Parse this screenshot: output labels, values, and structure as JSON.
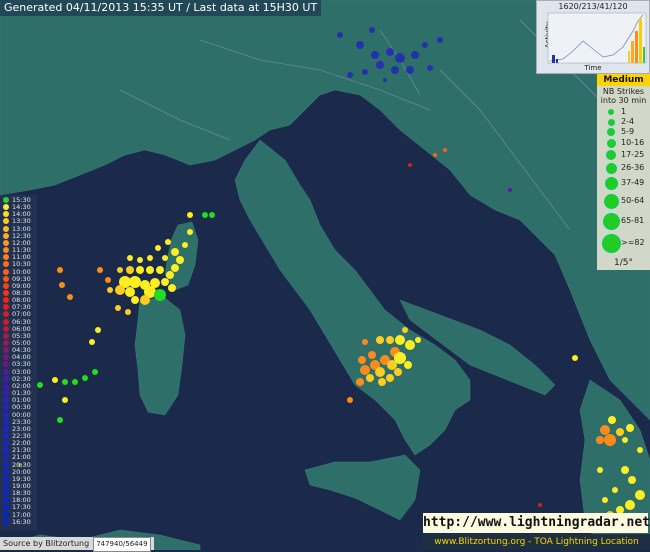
{
  "header": {
    "generated": "Generated 04/11/2013 15:35 UT / Last data at 15H30 UT"
  },
  "activity": {
    "title": "1620/213/41/120",
    "ylabel": "Activity",
    "xlabel": "Time"
  },
  "legend": {
    "title": "Medium",
    "subtitle": "NB Strikes into 30 min",
    "items": [
      "1",
      "2-4",
      "5-9",
      "10-16",
      "17-25",
      "26-36",
      "37-49",
      "50-64",
      "65-81",
      ">=82"
    ],
    "scale": "1/5°",
    "color": "#22cc22"
  },
  "timeline": [
    {
      "t": "15:30",
      "c": "#33cc33"
    },
    {
      "t": "14:30",
      "c": "#ffee33"
    },
    {
      "t": "14:00",
      "c": "#ffdd22"
    },
    {
      "t": "13:30",
      "c": "#ffcc22"
    },
    {
      "t": "13:00",
      "c": "#ffbb22"
    },
    {
      "t": "12:30",
      "c": "#ffaa22"
    },
    {
      "t": "12:00",
      "c": "#ff9922"
    },
    {
      "t": "11:30",
      "c": "#ff8c1a"
    },
    {
      "t": "11:00",
      "c": "#ff7f1a"
    },
    {
      "t": "10:30",
      "c": "#ff7014"
    },
    {
      "t": "10:00",
      "c": "#ff6314"
    },
    {
      "t": "09:30",
      "c": "#ff5511"
    },
    {
      "t": "09:00",
      "c": "#ff4411"
    },
    {
      "t": "08:30",
      "c": "#ff3311"
    },
    {
      "t": "08:00",
      "c": "#f52515"
    },
    {
      "t": "07:30",
      "c": "#e81c1c"
    },
    {
      "t": "07:00",
      "c": "#dd1a22"
    },
    {
      "t": "06:30",
      "c": "#cc1a30"
    },
    {
      "t": "06:00",
      "c": "#bb1a3c"
    },
    {
      "t": "05:30",
      "c": "#aa1a48"
    },
    {
      "t": "05:00",
      "c": "#991a55"
    },
    {
      "t": "04:30",
      "c": "#881a66"
    },
    {
      "t": "04:00",
      "c": "#771a77"
    },
    {
      "t": "03:30",
      "c": "#661a88"
    },
    {
      "t": "03:00",
      "c": "#551a99"
    },
    {
      "t": "02:30",
      "c": "#441aaa"
    },
    {
      "t": "02:00",
      "c": "#3a1ab5"
    },
    {
      "t": "01:30",
      "c": "#3320bb"
    },
    {
      "t": "01:00",
      "c": "#2d22c0"
    },
    {
      "t": "00:30",
      "c": "#2822c4"
    },
    {
      "t": "00:00",
      "c": "#2424c6"
    },
    {
      "t": "23:30",
      "c": "#2224c8"
    },
    {
      "t": "23:00",
      "c": "#2024c8"
    },
    {
      "t": "22:30",
      "c": "#1e24c8"
    },
    {
      "t": "22:00",
      "c": "#1c24c8"
    },
    {
      "t": "21:30",
      "c": "#1a24c8"
    },
    {
      "t": "21:00",
      "c": "#1824c8"
    },
    {
      "t": "20:30",
      "c": "#1624c8"
    },
    {
      "t": "20:00",
      "c": "#1424c8"
    },
    {
      "t": "19:30",
      "c": "#1224c8"
    },
    {
      "t": "19:00",
      "c": "#1024c8"
    },
    {
      "t": "18:30",
      "c": "#0e24c8"
    },
    {
      "t": "18:00",
      "c": "#0c24c8"
    },
    {
      "t": "17:30",
      "c": "#0a24c8"
    },
    {
      "t": "17:00",
      "c": "#0824c8"
    },
    {
      "t": "16:30",
      "c": "#0624c8"
    }
  ],
  "source": {
    "label": "Source by Blitzortung",
    "ids": "747940/56449"
  },
  "footer": {
    "url": "http://www.lightningradar.net",
    "credit": "www.Blitzortung.org - TOA Lightning Location"
  },
  "colors": {
    "sea": "#1b2a4a",
    "land": "#2f6f6a",
    "border": "#8aa0b0"
  }
}
